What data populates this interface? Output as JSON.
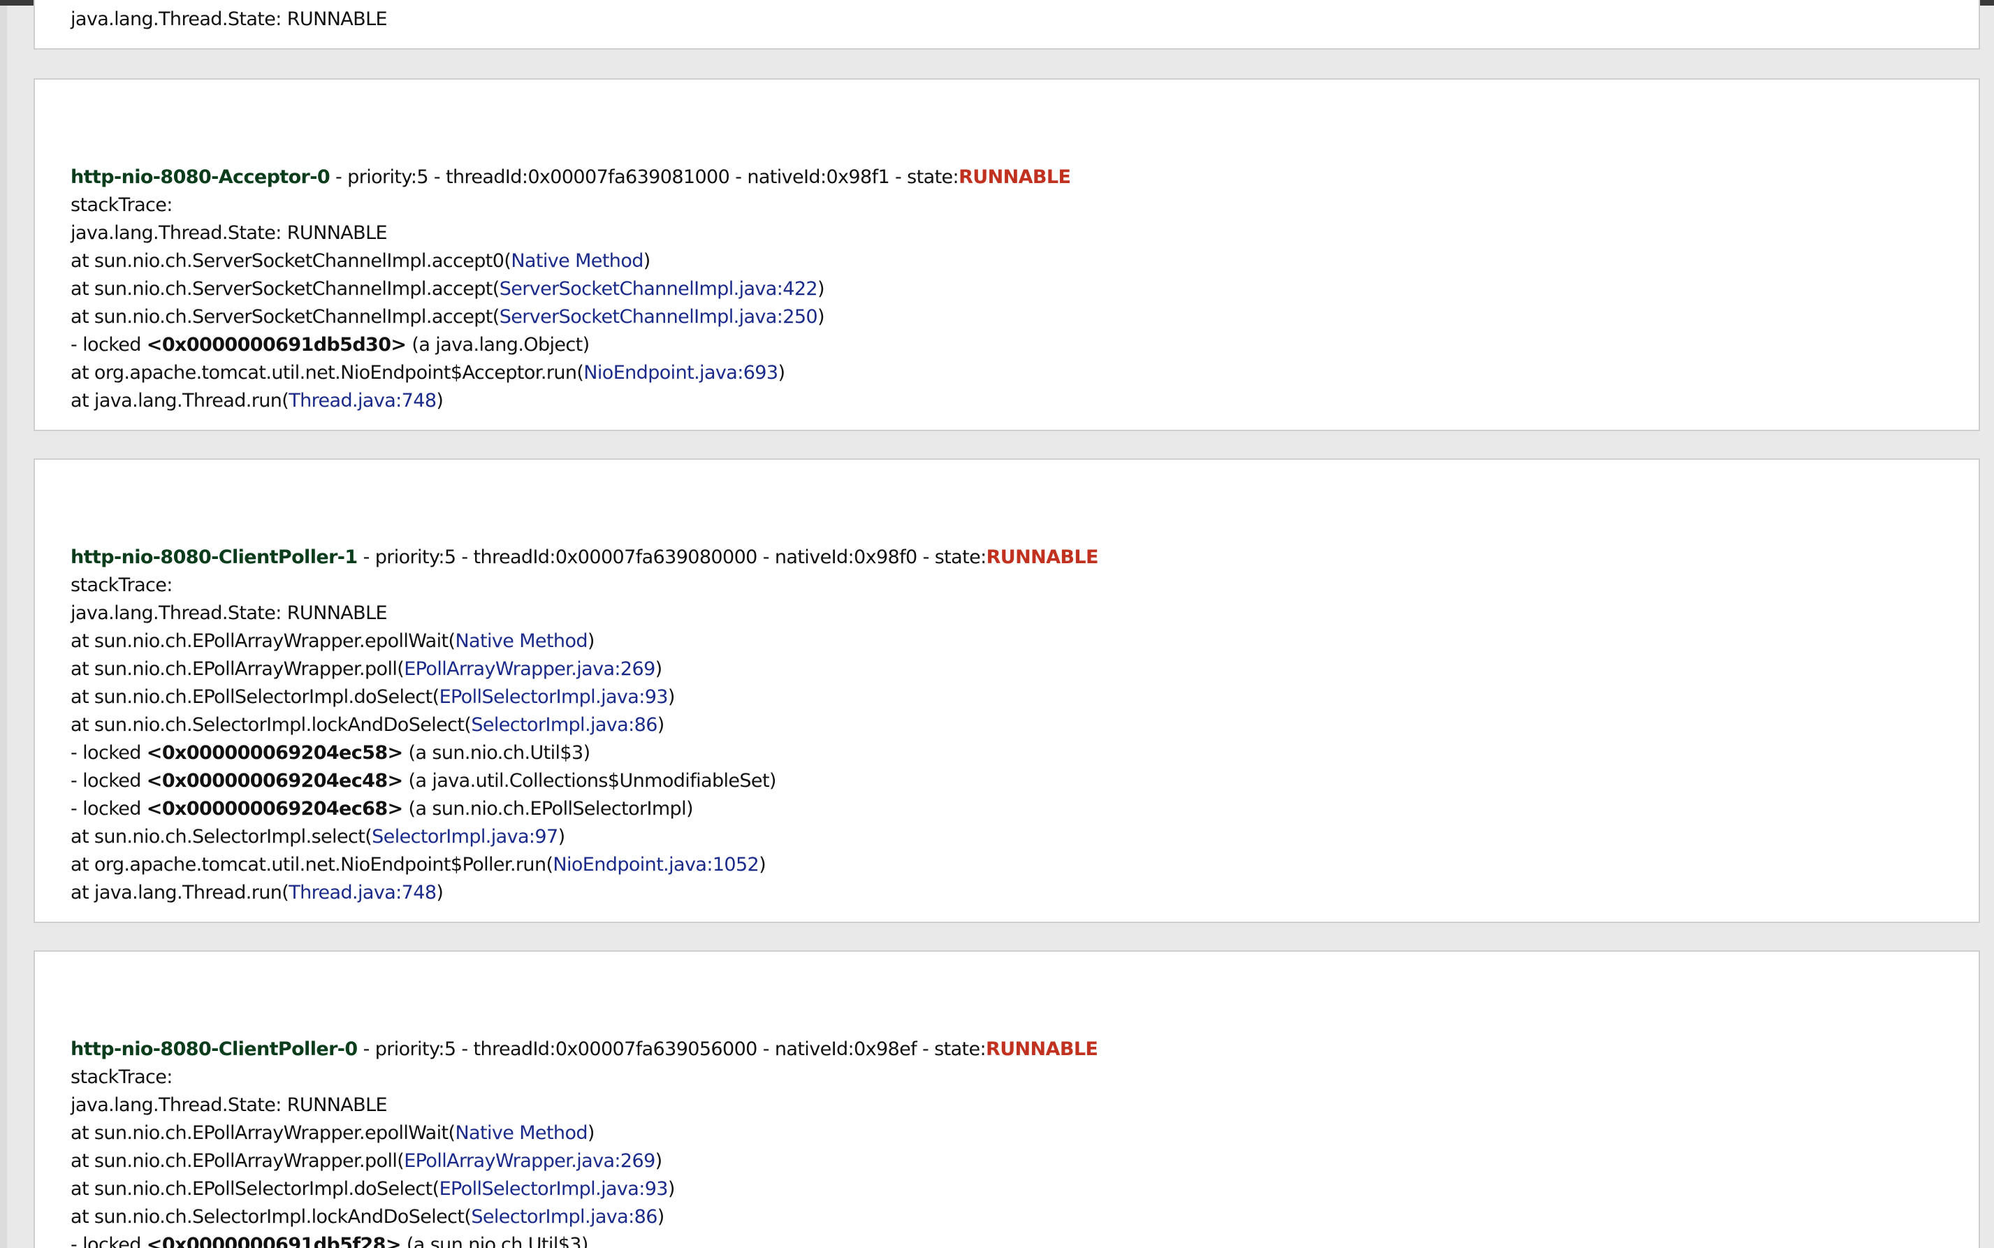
{
  "threads_top_fragment": {
    "line": "java.lang.Thread.State: RUNNABLE"
  },
  "threads": [
    {
      "name": "http-nio-8080-Acceptor-0",
      "meta": " - priority:5 - threadId:0x00007fa639081000 - nativeId:0x98f1 - state:",
      "state": "RUNNABLE",
      "stack_label": "stackTrace:",
      "state_line": "java.lang.Thread.State: RUNNABLE",
      "frames": [
        {
          "kind": "at",
          "prefix": "at sun.nio.ch.ServerSocketChannelImpl.accept0(",
          "src": "Native Method",
          "suffix": ")"
        },
        {
          "kind": "at",
          "prefix": "at sun.nio.ch.ServerSocketChannelImpl.accept(",
          "src": "ServerSocketChannelImpl.java:422",
          "suffix": ")"
        },
        {
          "kind": "at",
          "prefix": "at sun.nio.ch.ServerSocketChannelImpl.accept(",
          "src": "ServerSocketChannelImpl.java:250",
          "suffix": ")"
        },
        {
          "kind": "locked",
          "prefix": "- locked ",
          "addr": "<0x0000000691db5d30>",
          "suffix": " (a java.lang.Object)"
        },
        {
          "kind": "at",
          "prefix": "at org.apache.tomcat.util.net.NioEndpoint$Acceptor.run(",
          "src": "NioEndpoint.java:693",
          "suffix": ")"
        },
        {
          "kind": "at",
          "prefix": "at java.lang.Thread.run(",
          "src": "Thread.java:748",
          "suffix": ")"
        }
      ]
    },
    {
      "name": "http-nio-8080-ClientPoller-1",
      "meta": " - priority:5 - threadId:0x00007fa639080000 - nativeId:0x98f0 - state:",
      "state": "RUNNABLE",
      "stack_label": "stackTrace:",
      "state_line": "java.lang.Thread.State: RUNNABLE",
      "frames": [
        {
          "kind": "at",
          "prefix": "at sun.nio.ch.EPollArrayWrapper.epollWait(",
          "src": "Native Method",
          "suffix": ")"
        },
        {
          "kind": "at",
          "prefix": "at sun.nio.ch.EPollArrayWrapper.poll(",
          "src": "EPollArrayWrapper.java:269",
          "suffix": ")"
        },
        {
          "kind": "at",
          "prefix": "at sun.nio.ch.EPollSelectorImpl.doSelect(",
          "src": "EPollSelectorImpl.java:93",
          "suffix": ")"
        },
        {
          "kind": "at",
          "prefix": "at sun.nio.ch.SelectorImpl.lockAndDoSelect(",
          "src": "SelectorImpl.java:86",
          "suffix": ")"
        },
        {
          "kind": "locked",
          "prefix": "- locked ",
          "addr": "<0x000000069204ec58>",
          "suffix": " (a sun.nio.ch.Util$3)"
        },
        {
          "kind": "locked",
          "prefix": "- locked ",
          "addr": "<0x000000069204ec48>",
          "suffix": " (a java.util.Collections$UnmodifiableSet)"
        },
        {
          "kind": "locked",
          "prefix": "- locked ",
          "addr": "<0x000000069204ec68>",
          "suffix": " (a sun.nio.ch.EPollSelectorImpl)"
        },
        {
          "kind": "at",
          "prefix": "at sun.nio.ch.SelectorImpl.select(",
          "src": "SelectorImpl.java:97",
          "suffix": ")"
        },
        {
          "kind": "at",
          "prefix": "at org.apache.tomcat.util.net.NioEndpoint$Poller.run(",
          "src": "NioEndpoint.java:1052",
          "suffix": ")"
        },
        {
          "kind": "at",
          "prefix": "at java.lang.Thread.run(",
          "src": "Thread.java:748",
          "suffix": ")"
        }
      ]
    },
    {
      "name": "http-nio-8080-ClientPoller-0",
      "meta": " - priority:5 - threadId:0x00007fa639056000 - nativeId:0x98ef - state:",
      "state": "RUNNABLE",
      "stack_label": "stackTrace:",
      "state_line": "java.lang.Thread.State: RUNNABLE",
      "frames": [
        {
          "kind": "at",
          "prefix": "at sun.nio.ch.EPollArrayWrapper.epollWait(",
          "src": "Native Method",
          "suffix": ")"
        },
        {
          "kind": "at",
          "prefix": "at sun.nio.ch.EPollArrayWrapper.poll(",
          "src": "EPollArrayWrapper.java:269",
          "suffix": ")"
        },
        {
          "kind": "at",
          "prefix": "at sun.nio.ch.EPollSelectorImpl.doSelect(",
          "src": "EPollSelectorImpl.java:93",
          "suffix": ")"
        },
        {
          "kind": "at",
          "prefix": "at sun.nio.ch.SelectorImpl.lockAndDoSelect(",
          "src": "SelectorImpl.java:86",
          "suffix": ")"
        },
        {
          "kind": "locked",
          "prefix": "- locked ",
          "addr": "<0x0000000691db5f28>",
          "suffix": " (a sun.nio.ch.Util$3)"
        }
      ]
    }
  ],
  "colors": {
    "thread_name": "#0b3d1c",
    "state": "#c0311f",
    "source_link": "#1a2a8a",
    "page_bg": "#e9e9e9",
    "panel_bg": "#ffffff"
  }
}
